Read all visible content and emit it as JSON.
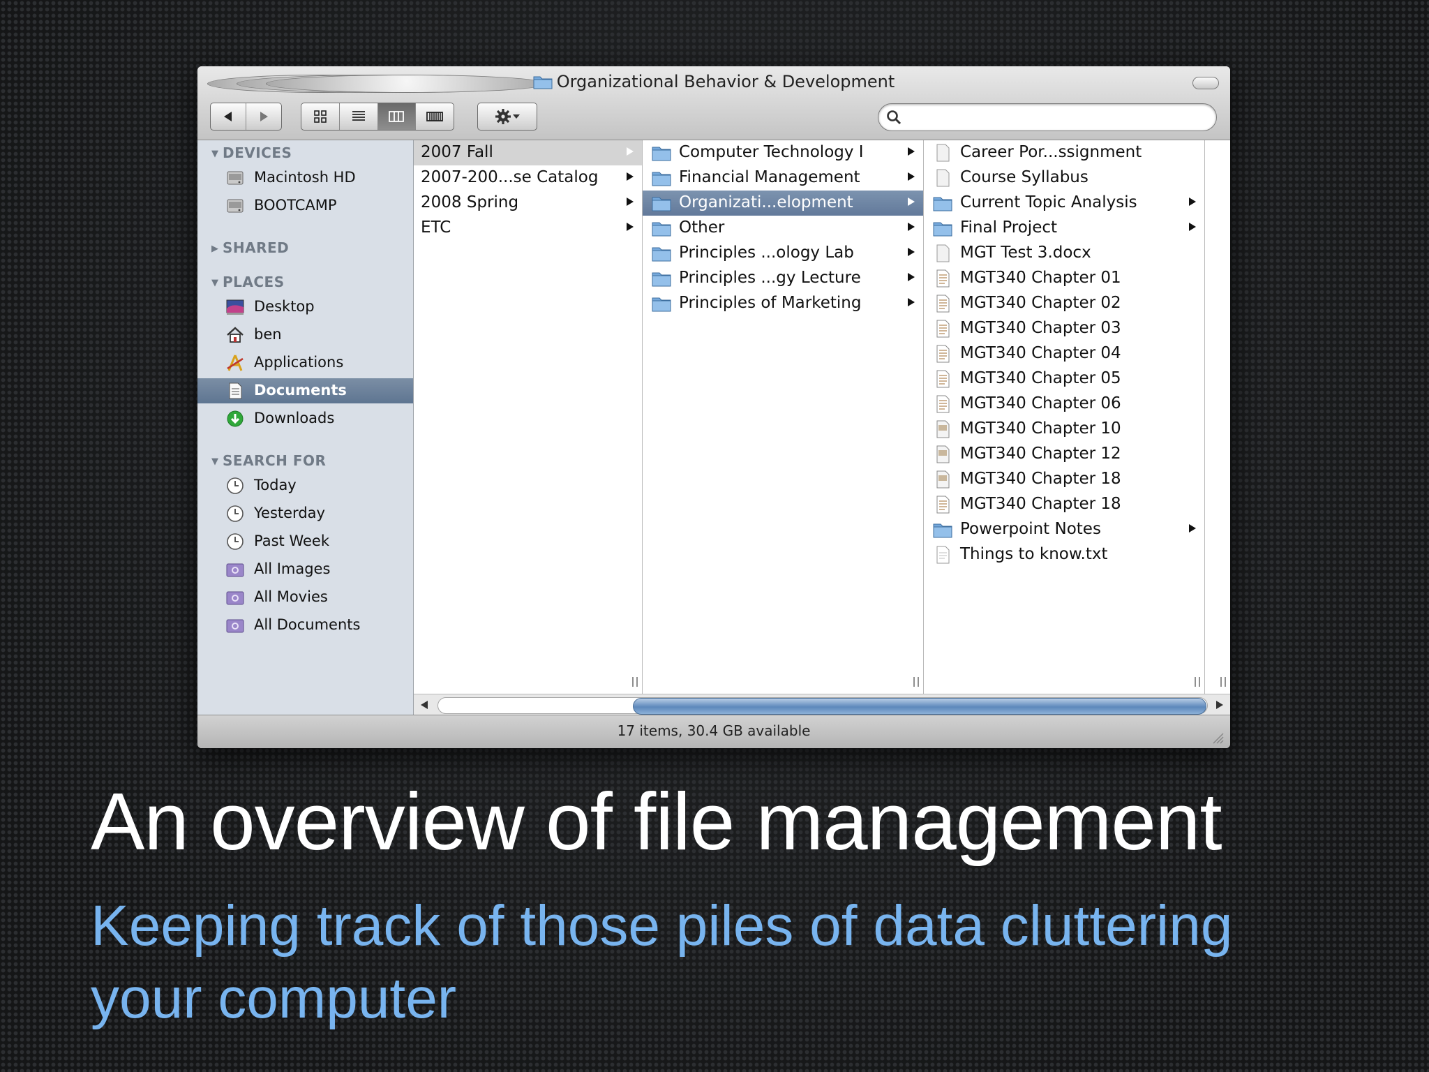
{
  "window": {
    "title": "Organizational Behavior & Development",
    "status": "17 items, 30.4 GB available",
    "search": {
      "value": "",
      "placeholder": ""
    }
  },
  "sidebar": {
    "sections": [
      {
        "label": "DEVICES",
        "expanded": true
      },
      {
        "label": "SHARED",
        "expanded": false
      },
      {
        "label": "PLACES",
        "expanded": true
      },
      {
        "label": "SEARCH FOR",
        "expanded": true
      }
    ],
    "devices": [
      {
        "label": "Macintosh HD",
        "icon": "hard-drive-icon"
      },
      {
        "label": "BOOTCAMP",
        "icon": "hard-drive-icon"
      }
    ],
    "places": [
      {
        "label": "Desktop",
        "icon": "desktop-icon"
      },
      {
        "label": "ben",
        "icon": "home-icon"
      },
      {
        "label": "Applications",
        "icon": "applications-icon"
      },
      {
        "label": "Documents",
        "icon": "documents-icon",
        "selected": true
      },
      {
        "label": "Downloads",
        "icon": "downloads-icon"
      }
    ],
    "search_for": [
      {
        "label": "Today",
        "icon": "clock-icon"
      },
      {
        "label": "Yesterday",
        "icon": "clock-icon"
      },
      {
        "label": "Past Week",
        "icon": "clock-icon"
      },
      {
        "label": "All Images",
        "icon": "smart-folder-icon"
      },
      {
        "label": "All Movies",
        "icon": "smart-folder-icon"
      },
      {
        "label": "All Documents",
        "icon": "smart-folder-icon"
      }
    ]
  },
  "columns": {
    "col1": [
      {
        "label": "2007 Fall"
      },
      {
        "label": "2007-200...se Catalog"
      },
      {
        "label": "2008 Spring"
      },
      {
        "label": "ETC"
      }
    ],
    "col2": [
      {
        "label": "Computer Technology I"
      },
      {
        "label": "Financial Management"
      },
      {
        "label": "Organizati...elopment"
      },
      {
        "label": "Other"
      },
      {
        "label": "Principles ...ology Lab"
      },
      {
        "label": "Principles ...gy Lecture"
      },
      {
        "label": "Principles of Marketing"
      }
    ],
    "col3": [
      {
        "label": "Career Por...ssignment"
      },
      {
        "label": "Course Syllabus"
      },
      {
        "label": "Current Topic Analysis"
      },
      {
        "label": "Final Project"
      },
      {
        "label": "MGT Test 3.docx"
      },
      {
        "label": "MGT340 Chapter 01"
      },
      {
        "label": "MGT340 Chapter 02"
      },
      {
        "label": "MGT340 Chapter 03"
      },
      {
        "label": "MGT340 Chapter 04"
      },
      {
        "label": "MGT340 Chapter 05"
      },
      {
        "label": "MGT340 Chapter 06"
      },
      {
        "label": "MGT340 Chapter 10"
      },
      {
        "label": "MGT340 Chapter 12"
      },
      {
        "label": "MGT340 Chapter 18"
      },
      {
        "label": "MGT340 Chapter 18"
      },
      {
        "label": "Powerpoint Notes"
      },
      {
        "label": "Things to know.txt"
      }
    ]
  },
  "slide": {
    "title": "An overview of file management",
    "subtitle": "Keeping track of those piles of data cluttering your computer"
  },
  "colors": {
    "selection_blue": "#62799a",
    "sidebar_bg": "#d9dfe7",
    "subtitle_blue": "#78b4ef"
  }
}
